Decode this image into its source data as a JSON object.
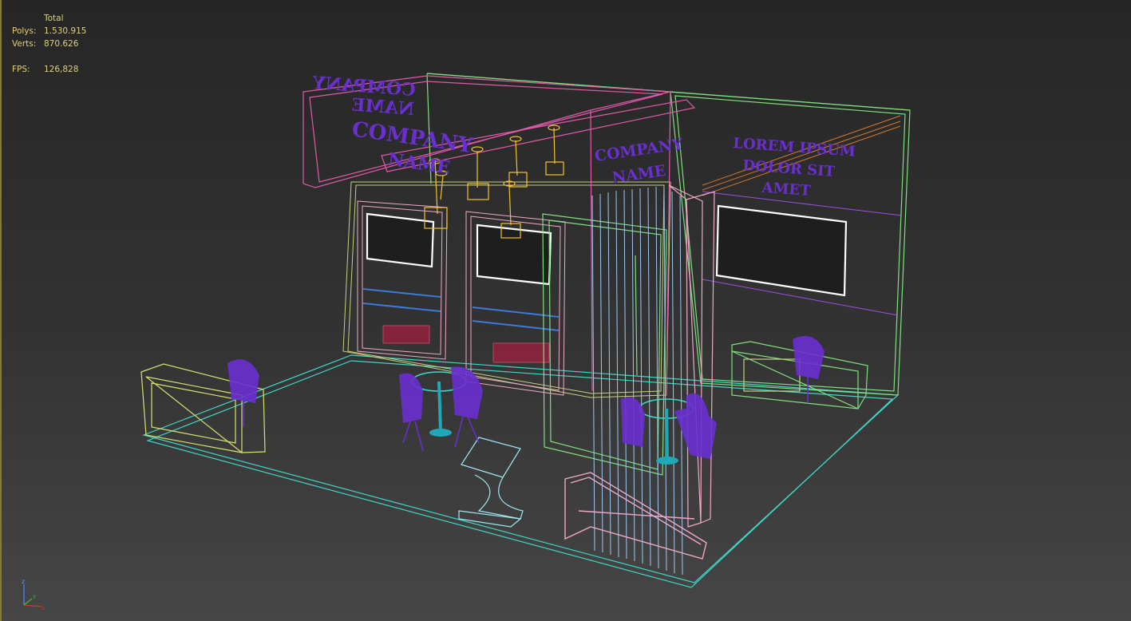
{
  "stats": {
    "header": "Total",
    "polys_label": "Polys:",
    "polys_value": "1.530.915",
    "verts_label": "Verts:",
    "verts_value": "870.626",
    "fps_label": "FPS:",
    "fps_value": "126,828"
  },
  "signs": {
    "left_header_line1": "COMPANY",
    "left_header_line2": "NAME",
    "mirrored_line1": "COMPANY",
    "mirrored_line2": "NAME",
    "column_line1": "COMPANY",
    "column_line2": "NAME",
    "right_line1": "LOREM IPSUM",
    "right_line2": "DOLOR SIT",
    "right_line3": "AMET"
  },
  "axis": {
    "z_label": "z",
    "x_label": "x",
    "y_label": "y"
  },
  "colors": {
    "stats_text": "#e0d07a",
    "floor_wire": "#3fd6c6",
    "wall_wire": "#7ee07e",
    "header_wire": "#e05aa8",
    "light_wire": "#f2c230",
    "furniture": "#6a2fd0",
    "screen_frame": "#ffffff"
  }
}
